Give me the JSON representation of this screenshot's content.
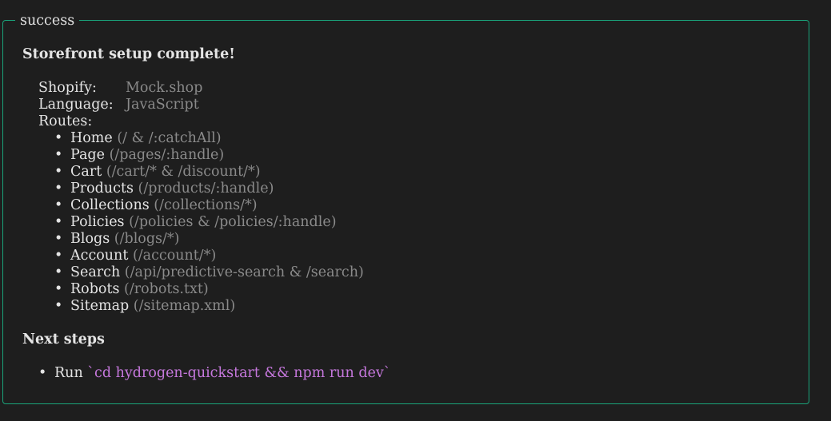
{
  "box": {
    "label": "success",
    "border_color": "#1aa37a"
  },
  "heading": "Storefront setup complete!",
  "info": [
    {
      "key": "Shopify:",
      "value": "Mock.shop"
    },
    {
      "key": "Language:",
      "value": "JavaScript"
    },
    {
      "key": "Routes:",
      "value": ""
    }
  ],
  "bullet_glyph": "•",
  "routes": [
    {
      "name": "Home",
      "path": "(/ & /:catchAll)"
    },
    {
      "name": "Page",
      "path": "(/pages/:handle)"
    },
    {
      "name": "Cart",
      "path": "(/cart/* & /discount/*)"
    },
    {
      "name": "Products",
      "path": "(/products/:handle)"
    },
    {
      "name": "Collections",
      "path": "(/collections/*)"
    },
    {
      "name": "Policies",
      "path": "(/policies & /policies/:handle)"
    },
    {
      "name": "Blogs",
      "path": "(/blogs/*)"
    },
    {
      "name": "Account",
      "path": "(/account/*)"
    },
    {
      "name": "Search",
      "path": "(/api/predictive-search & /search)"
    },
    {
      "name": "Robots",
      "path": "(/robots.txt)"
    },
    {
      "name": "Sitemap",
      "path": "(/sitemap.xml)"
    }
  ],
  "next_steps": {
    "heading": "Next steps",
    "items": [
      {
        "prefix": "Run",
        "command": "`cd hydrogen-quickstart && npm run dev`"
      }
    ]
  },
  "colors": {
    "background": "#1e1e1e",
    "text": "#e4e4e4",
    "dim": "#8a8a8a",
    "command": "#c678dd"
  }
}
